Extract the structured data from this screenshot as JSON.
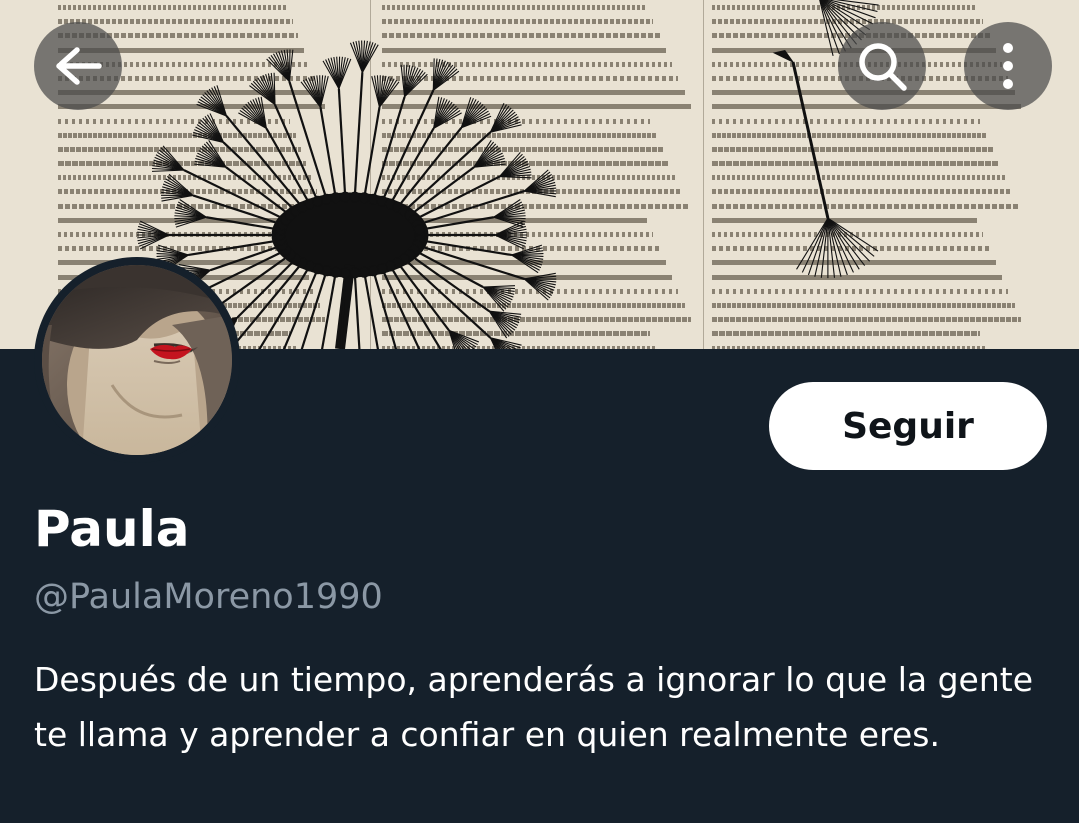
{
  "header": {
    "back_icon": "arrow-left-icon",
    "search_icon": "search-icon",
    "more_icon": "more-vertical-icon",
    "overlay_button_color": "#4b4b4b"
  },
  "banner": {
    "description_text_color": "#4a4338",
    "background_color": "#e9e2d3"
  },
  "profile": {
    "follow_label": "Seguir",
    "display_name": "Paula",
    "handle": "@PaulaMoreno1990",
    "bio": "Después de un tiempo, aprenderás a ignorar lo que la gente te llama y aprender a confiar en quien realmente eres."
  },
  "theme": {
    "background": "#15202b",
    "text_primary": "#ffffff",
    "text_secondary": "#8b98a5",
    "button_bg": "#ffffff",
    "button_text": "#0f1419"
  }
}
